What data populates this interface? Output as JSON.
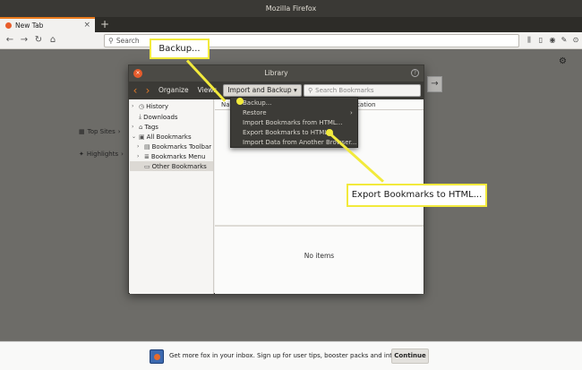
{
  "window": {
    "title": "Mozilla Firefox"
  },
  "tabs": [
    {
      "label": "New Tab"
    }
  ],
  "newtab_button": "+",
  "urlbar": {
    "placeholder": "Search"
  },
  "newtab_page": {
    "top_sites": "Top Sites",
    "highlights": "Highlights"
  },
  "library": {
    "title": "Library",
    "toolbar": {
      "organize": "Organize",
      "views": "Views",
      "import_backup": "Import and Backup",
      "search_placeholder": "Search Bookmarks"
    },
    "tree": [
      {
        "label": "History"
      },
      {
        "label": "Downloads"
      },
      {
        "label": "Tags"
      },
      {
        "label": "All Bookmarks"
      },
      {
        "label": "Bookmarks Toolbar"
      },
      {
        "label": "Bookmarks Menu"
      },
      {
        "label": "Other Bookmarks"
      }
    ],
    "columns": {
      "name": "Name",
      "location": "Location"
    },
    "empty_text": "No items"
  },
  "import_menu": {
    "items": [
      {
        "label": "Backup..."
      },
      {
        "label": "Restore"
      },
      {
        "label": "Import Bookmarks from HTML..."
      },
      {
        "label": "Export Bookmarks to HTML..."
      },
      {
        "label": "Import Data from Another Browser..."
      }
    ]
  },
  "callouts": {
    "backup": "Backup...",
    "export": "Export Bookmarks to HTML..."
  },
  "snippet": {
    "text": "Get more fox in your inbox. Sign up for user tips, booster packs and internet intel.",
    "button": "Continue"
  },
  "colors": {
    "accent_yellow": "#f2ea3c",
    "firefox_orange": "#e85d2a"
  }
}
